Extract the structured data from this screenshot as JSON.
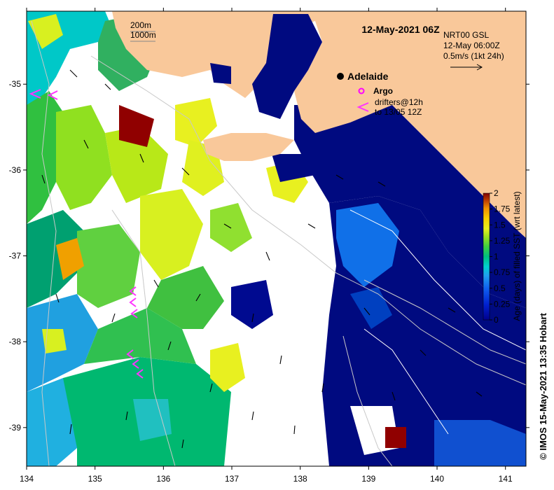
{
  "map": {
    "title": "12-May-2021 06Z",
    "contours": [
      "200m",
      "1000m"
    ],
    "velocity_source": "NRT00 GSL",
    "velocity_time": "12-May 06:00Z",
    "velocity_scale": "0.5m/s (1kt 24h)",
    "city": "Adelaide",
    "argo_label": "Argo",
    "drifters_line1": "drifters@12h",
    "drifters_line2": "to 13/05 12Z",
    "credit": "©  IMOS 15-May-2021 13:35 Hobart",
    "colors": {
      "land": "#f9c89a",
      "deep_navy": "#000a80",
      "argo": "#ff00ff",
      "drifter": "#ff33ff",
      "ocean_background": "#ffffff"
    },
    "lon_ticks": [
      134,
      135,
      136,
      137,
      138,
      139,
      140,
      141
    ],
    "lat_ticks": [
      -35,
      -36,
      -37,
      -38,
      -39
    ],
    "lon_range": [
      134,
      141.3
    ],
    "lat_range": [
      -39.45,
      -34.15
    ]
  },
  "colorbar": {
    "label": "Age (days) of filled SST (wrt latest)",
    "ticks": [
      "2",
      "1.75",
      "1.5",
      "1.25",
      "1",
      "0.75",
      "0.5",
      "0.25",
      "0"
    ],
    "range": [
      0,
      2
    ]
  }
}
